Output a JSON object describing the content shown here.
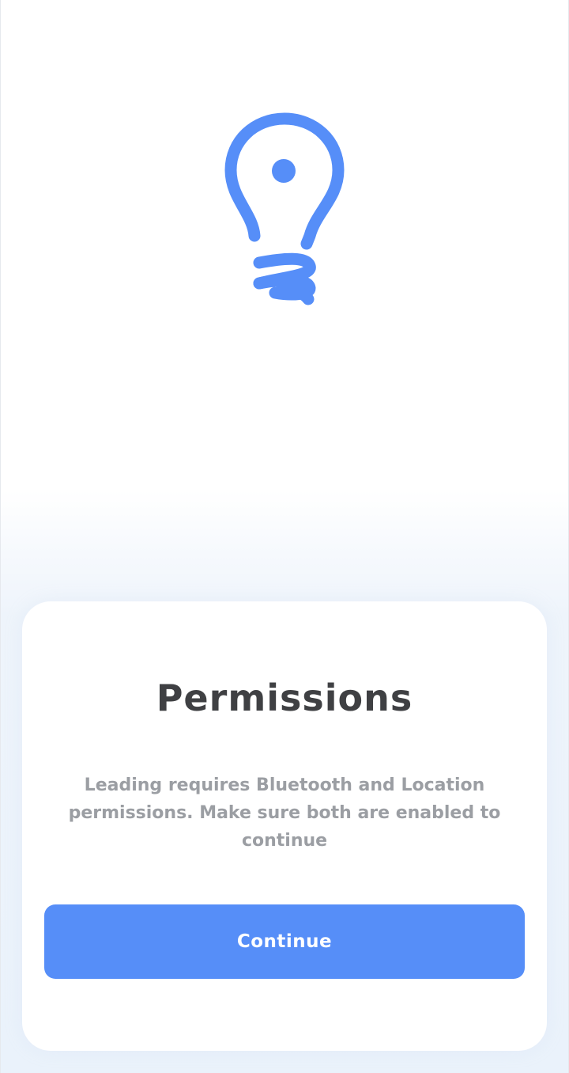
{
  "colors": {
    "accent": "#568ef8",
    "title_text": "#3f4043",
    "body_text": "#9b9ea3",
    "card_bg": "#ffffff",
    "button_text": "#ffffff"
  },
  "hero": {
    "icon": "lightbulb-icon"
  },
  "permissions_card": {
    "title": "Permissions",
    "description": "Leading requires Bluetooth and Location permissions. Make sure both are enabled to continue",
    "continue_label": "Continue"
  }
}
